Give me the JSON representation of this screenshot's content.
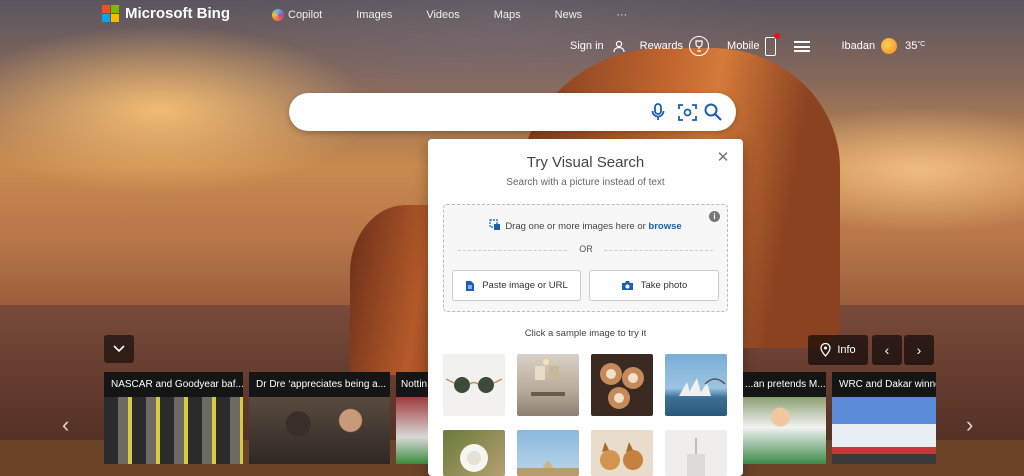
{
  "header": {
    "brand": "Microsoft Bing",
    "nav": [
      "Copilot",
      "Images",
      "Videos",
      "Maps",
      "News",
      "···"
    ],
    "sign_in": "Sign in",
    "rewards": "Rewards",
    "mobile": "Mobile",
    "location": "Ibadan",
    "temperature": "35",
    "temp_unit": "°C"
  },
  "search": {
    "placeholder": "",
    "value": ""
  },
  "visual_search": {
    "title": "Try Visual Search",
    "subtitle": "Search with a picture instead of text",
    "drop_text": "Drag one or more images here or",
    "browse": "browse",
    "or": "OR",
    "paste": "Paste image or URL",
    "take_photo": "Take photo",
    "sample_label": "Click a sample image to try it",
    "samples": [
      "sunglasses",
      "dining-room",
      "latte-art",
      "sydney-opera-house",
      "white-rose",
      "louvre",
      "dogs",
      "white-decor"
    ]
  },
  "carousel": {
    "info_label": "Info",
    "cards": [
      "NASCAR and Goodyear baf...",
      "Dr Dre ‘appreciates being a...",
      "Nottin",
      "...an pretends M...",
      "WRC and Dakar winne"
    ]
  },
  "colors": {
    "accent": "#1a5fb4",
    "search_icon": "#1a5fb4"
  }
}
